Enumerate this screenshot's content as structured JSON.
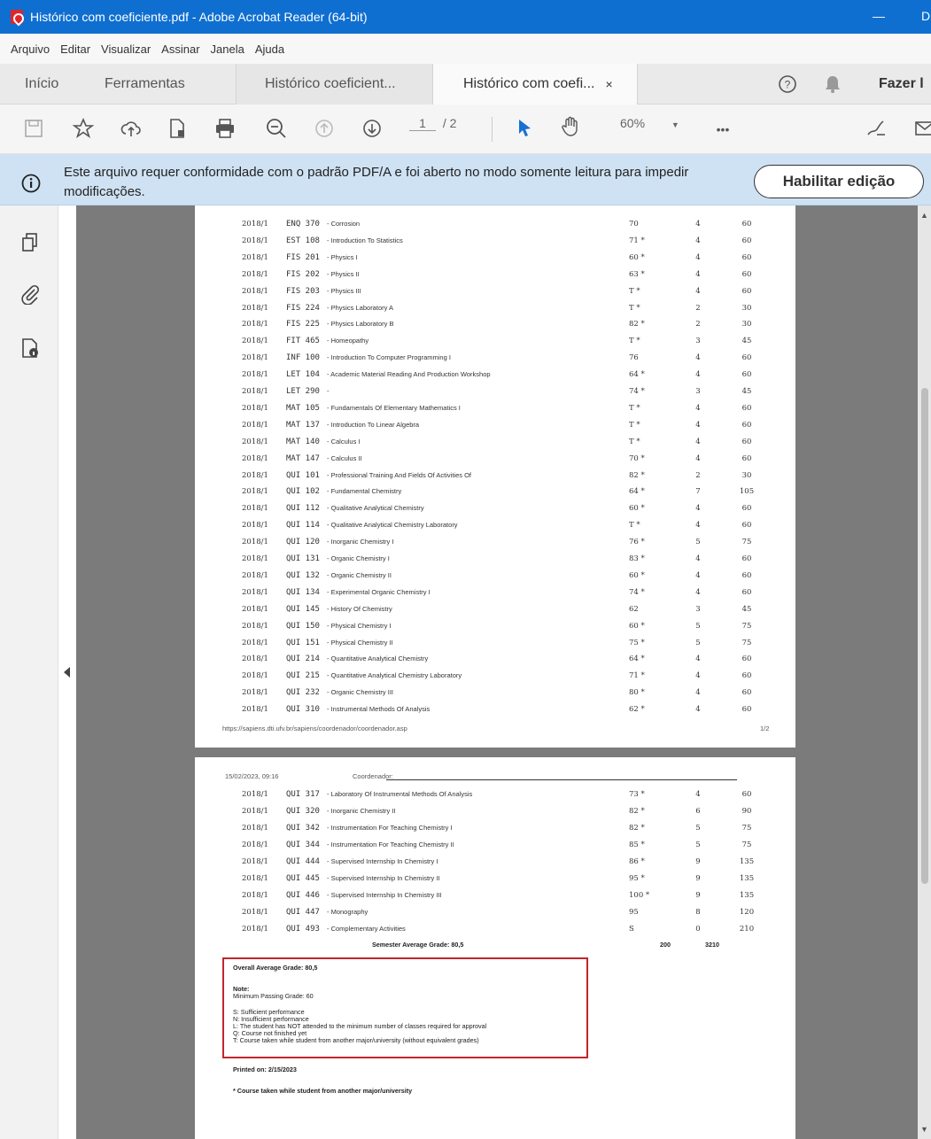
{
  "window": {
    "title": "Histórico com coeficiente.pdf - Adobe Acrobat Reader (64-bit)",
    "min_label": "—",
    "max_label": "D"
  },
  "menu": [
    "Arquivo",
    "Editar",
    "Visualizar",
    "Assinar",
    "Janela",
    "Ajuda"
  ],
  "tabs": {
    "home": "Início",
    "tools": "Ferramentas",
    "doc1": "Histórico coeficient...",
    "doc2": "Histórico com coefi...",
    "close": "×",
    "signin": "Fazer l"
  },
  "toolbar": {
    "page_current": "1",
    "page_total": "/ 2",
    "zoom": "60%",
    "more": "•••"
  },
  "infobar": {
    "message": "Este arquivo requer conformidade com o padrão PDF/A e foi aberto no modo somente leitura para impedir modificações.",
    "button": "Habilitar edição"
  },
  "page1": {
    "rows": [
      {
        "term": "2018/1",
        "code": "ENQ 370",
        "name": "- Corrosion",
        "grade": "70",
        "credits": "4",
        "hours": "60"
      },
      {
        "term": "2018/1",
        "code": "EST 108",
        "name": "- Introduction To Statistics",
        "grade": "71 *",
        "credits": "4",
        "hours": "60"
      },
      {
        "term": "2018/1",
        "code": "FIS 201",
        "name": "- Physics I",
        "grade": "60 *",
        "credits": "4",
        "hours": "60"
      },
      {
        "term": "2018/1",
        "code": "FIS 202",
        "name": "- Physics II",
        "grade": "63 *",
        "credits": "4",
        "hours": "60"
      },
      {
        "term": "2018/1",
        "code": "FIS 203",
        "name": "- Physics III",
        "grade": "T *",
        "credits": "4",
        "hours": "60"
      },
      {
        "term": "2018/1",
        "code": "FIS 224",
        "name": "- Physics Laboratory A",
        "grade": "T *",
        "credits": "2",
        "hours": "30"
      },
      {
        "term": "2018/1",
        "code": "FIS 225",
        "name": "- Physics Laboratory B",
        "grade": "82 *",
        "credits": "2",
        "hours": "30"
      },
      {
        "term": "2018/1",
        "code": "FIT 465",
        "name": "- Homeopathy",
        "grade": "T *",
        "credits": "3",
        "hours": "45"
      },
      {
        "term": "2018/1",
        "code": "INF 100",
        "name": "- Introduction To Computer Programming I",
        "grade": "76",
        "credits": "4",
        "hours": "60"
      },
      {
        "term": "2018/1",
        "code": "LET 104",
        "name": "- Academic Material Reading And Production Workshop",
        "grade": "64 *",
        "credits": "4",
        "hours": "60"
      },
      {
        "term": "2018/1",
        "code": "LET 290",
        "name": "-",
        "grade": "74 *",
        "credits": "3",
        "hours": "45"
      },
      {
        "term": "2018/1",
        "code": "MAT 105",
        "name": "- Fundamentals Of Elementary Mathematics I",
        "grade": "T *",
        "credits": "4",
        "hours": "60"
      },
      {
        "term": "2018/1",
        "code": "MAT 137",
        "name": "- Introduction To Linear Algebra",
        "grade": "T *",
        "credits": "4",
        "hours": "60"
      },
      {
        "term": "2018/1",
        "code": "MAT 140",
        "name": "- Calculus I",
        "grade": "T *",
        "credits": "4",
        "hours": "60"
      },
      {
        "term": "2018/1",
        "code": "MAT 147",
        "name": "- Calculus II",
        "grade": "70 *",
        "credits": "4",
        "hours": "60"
      },
      {
        "term": "2018/1",
        "code": "QUI 101",
        "name": "- Professional Training And Fields Of Activities Of",
        "grade": "82 *",
        "credits": "2",
        "hours": "30"
      },
      {
        "term": "2018/1",
        "code": "QUI 102",
        "name": "- Fundamental Chemistry",
        "grade": "64 *",
        "credits": "7",
        "hours": "105"
      },
      {
        "term": "2018/1",
        "code": "QUI 112",
        "name": "- Qualitative Analytical Chemistry",
        "grade": "60 *",
        "credits": "4",
        "hours": "60"
      },
      {
        "term": "2018/1",
        "code": "QUI 114",
        "name": "- Qualitative Analytical Chemistry Laboratory",
        "grade": "T *",
        "credits": "4",
        "hours": "60"
      },
      {
        "term": "2018/1",
        "code": "QUI 120",
        "name": "- Inorganic Chemistry I",
        "grade": "76 *",
        "credits": "5",
        "hours": "75"
      },
      {
        "term": "2018/1",
        "code": "QUI 131",
        "name": "- Organic Chemistry I",
        "grade": "83 *",
        "credits": "4",
        "hours": "60"
      },
      {
        "term": "2018/1",
        "code": "QUI 132",
        "name": "- Organic Chemistry II",
        "grade": "60 *",
        "credits": "4",
        "hours": "60"
      },
      {
        "term": "2018/1",
        "code": "QUI 134",
        "name": "- Experimental Organic Chemistry I",
        "grade": "74 *",
        "credits": "4",
        "hours": "60"
      },
      {
        "term": "2018/1",
        "code": "QUI 145",
        "name": "- History Of Chemistry",
        "grade": "62",
        "credits": "3",
        "hours": "45"
      },
      {
        "term": "2018/1",
        "code": "QUI 150",
        "name": "- Physical Chemistry I",
        "grade": "60 *",
        "credits": "5",
        "hours": "75"
      },
      {
        "term": "2018/1",
        "code": "QUI 151",
        "name": "- Physical Chemistry II",
        "grade": "75 *",
        "credits": "5",
        "hours": "75"
      },
      {
        "term": "2018/1",
        "code": "QUI 214",
        "name": "- Quantitative Analytical Chemistry",
        "grade": "64 *",
        "credits": "4",
        "hours": "60"
      },
      {
        "term": "2018/1",
        "code": "QUI 215",
        "name": "- Quantitative Analytical Chemistry Laboratory",
        "grade": "71 *",
        "credits": "4",
        "hours": "60"
      },
      {
        "term": "2018/1",
        "code": "QUI 232",
        "name": "- Organic Chemistry III",
        "grade": "80 *",
        "credits": "4",
        "hours": "60"
      },
      {
        "term": "2018/1",
        "code": "QUI 310",
        "name": "- Instrumental Methods Of Analysis",
        "grade": "62 *",
        "credits": "4",
        "hours": "60"
      }
    ],
    "url": "https://sapiens.dti.ufv.br/sapiens/coordenador/coordenador.asp",
    "page_num": "1/2"
  },
  "page2": {
    "header_date": "15/02/2023, 09:16",
    "header_label": "Coordenador:",
    "rows": [
      {
        "term": "2018/1",
        "code": "QUI 317",
        "name": "- Laboratory Of Instrumental Methods Of Analysis",
        "grade": "73 *",
        "credits": "4",
        "hours": "60"
      },
      {
        "term": "2018/1",
        "code": "QUI 320",
        "name": "- Inorganic Chemistry II",
        "grade": "82 *",
        "credits": "6",
        "hours": "90"
      },
      {
        "term": "2018/1",
        "code": "QUI 342",
        "name": "- Instrumentation For Teaching Chemistry I",
        "grade": "82 *",
        "credits": "5",
        "hours": "75"
      },
      {
        "term": "2018/1",
        "code": "QUI 344",
        "name": "- Instrumentation For Teaching Chemistry II",
        "grade": "85 *",
        "credits": "5",
        "hours": "75"
      },
      {
        "term": "2018/1",
        "code": "QUI 444",
        "name": "- Supervised Internship In Chemistry I",
        "grade": "86 *",
        "credits": "9",
        "hours": "135"
      },
      {
        "term": "2018/1",
        "code": "QUI 445",
        "name": "- Supervised Internship In Chemistry II",
        "grade": "95 *",
        "credits": "9",
        "hours": "135"
      },
      {
        "term": "2018/1",
        "code": "QUI 446",
        "name": "- Supervised Internship In Chemistry III",
        "grade": "100 *",
        "credits": "9",
        "hours": "135"
      },
      {
        "term": "2018/1",
        "code": "QUI 447",
        "name": "- Monography",
        "grade": "95",
        "credits": "8",
        "hours": "120"
      },
      {
        "term": "2018/1",
        "code": "QUI 493",
        "name": "- Complementary Activities",
        "grade": "S",
        "credits": "0",
        "hours": "210"
      }
    ],
    "semester_avg": "Semester Average Grade: 80,5",
    "total_credits": "200",
    "total_hours": "3210",
    "overall": "Overall Average Grade: 80,5",
    "note_title": "Note:",
    "min_grade": "Minimum Passing Grade: 60",
    "legend": [
      "S: Sufficient performance",
      "N: Insufficient performance",
      "L: The student has NOT attended to the minimum number of classes required for approval",
      "Q: Course not finished yet",
      "T: Course taken while student from another major/university (without equivalent grades)"
    ],
    "printed_on": "Printed on: 2/15/2023",
    "footnote": "* Course taken while student from another major/university"
  },
  "colors": {
    "title_bar": "#0f6fd1",
    "info_bar": "#cfe2f3",
    "highlight_box": "#c0262c"
  }
}
